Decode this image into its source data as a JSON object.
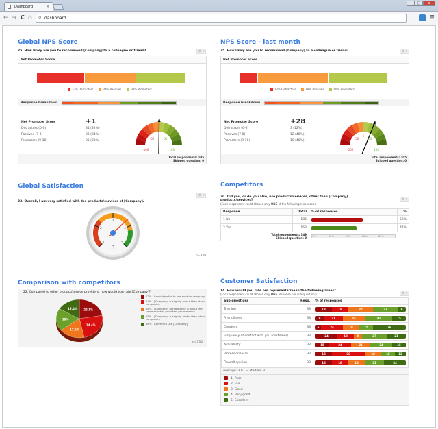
{
  "browser": {
    "tab_title": "Dashboard",
    "tab_close": "×",
    "address": "dashboard",
    "back": "←",
    "forward": "→",
    "reload": "C",
    "home": "⌂",
    "menu": "≡",
    "minimize": "–",
    "maximize": "□",
    "close": "x"
  },
  "colors": {
    "title_blue": "#3a7be0",
    "detractor": "#e8302a",
    "passive": "#f89a3e",
    "promoter": "#b4c84b",
    "poor": "#9b0d0d",
    "fair": "#d81010",
    "good": "#f0761e",
    "very_good": "#6ba12a",
    "excellent": "#3f6b13"
  },
  "gear_label": "⚙ ▾",
  "nps_global": {
    "title": "Global NPS Score",
    "question": "25.  How likely are you to recommend [Company] to a colleague or friend?",
    "header": "Net Promoter Score",
    "detractors_pct": 32,
    "passives_pct": 34,
    "promoters_pct": 33,
    "legend": [
      "32% Detractors",
      "34% Passives",
      "33% Promoters"
    ],
    "breakdown_label": "Response breakdown",
    "score_label": "Net Promoter Score",
    "score": "+1",
    "rows": [
      {
        "label": "Detractors (0-6)",
        "value": "34 (32%)"
      },
      {
        "label": "Passives (7-8)",
        "value": "36 (34%)"
      },
      {
        "label": "Promoters (9-10)",
        "value": "35 (33%)"
      }
    ],
    "gauge_value": 1,
    "gauge_labels": [
      "-100",
      "-50",
      "50",
      "100"
    ],
    "total": "Total respondents: 105",
    "skipped": "Skipped question: 0"
  },
  "nps_month": {
    "title": "NPS Score - last month",
    "question": "25.  How likely are you to recommend [Company] to a colleague or friend?",
    "header": "Net Promoter Score",
    "detractors_pct": 12,
    "passives_pct": 48,
    "promoters_pct": 40,
    "legend": [
      "12% Detractors",
      "48% Passives",
      "40% Promoters"
    ],
    "breakdown_label": "Response breakdown",
    "score_label": "Net Promoter Score",
    "score": "+28",
    "rows": [
      {
        "label": "Detractors (0-6)",
        "value": "3 (12%)"
      },
      {
        "label": "Passives (7-8)",
        "value": "12 (48%)"
      },
      {
        "label": "Promoters (9-10)",
        "value": "10 (40%)"
      }
    ],
    "gauge_value": 28,
    "gauge_labels": [
      "-100",
      "-50",
      "0",
      "50",
      "100"
    ],
    "total": "Total respondents: 105",
    "skipped": "Skipped question: 0"
  },
  "global_satisfaction": {
    "title": "Global Satisfaction",
    "question": "23. Overall, I am very satisfied with the products/services of [Company].",
    "gauge_value": "3",
    "gauge_needle": 3.7,
    "ticks": [
      "1",
      "2",
      "3",
      "4",
      "5"
    ],
    "n": "n=320"
  },
  "competitors": {
    "title": "Competitors",
    "question": "20.  Did you, or do you also, use products/services, other than [Company] products/services?",
    "note_pre": "(Each respondent could choose only ",
    "note_bold": "ONE",
    "note_post": " of the following responses.)",
    "headers": [
      "Response",
      "Total",
      "% of responses",
      "%"
    ],
    "rows": [
      {
        "label": "1 No",
        "total": "186",
        "pct": 53,
        "pct_label": "53%",
        "color": "#b30d0d"
      },
      {
        "label": "2 Yes",
        "total": "163",
        "pct": 47,
        "pct_label": "47%",
        "color": "#4b8a1a"
      }
    ],
    "total": "Total respondents: 349",
    "skipped": "Skipped question: 0",
    "axis": [
      "0%",
      "20%",
      "40%",
      "60%",
      "80%"
    ]
  },
  "comparison": {
    "title": "Comparison with competitors",
    "question": "22. Compared to other product/service providers, how would you rate [Company]?",
    "n": "n=336",
    "chart_data": {
      "type": "pie",
      "title": "22. Compared to other product/service providers, how would you rate [Company]?",
      "slices": [
        {
          "label": "22% - I would prefer to use another company",
          "value": 22.3,
          "data_label": "22.3%",
          "color": "#9b0d0d"
        },
        {
          "label": "24% - [Company] is slightly worse than other companies",
          "value": 24.4,
          "data_label": "24.4%",
          "color": "#d81010"
        },
        {
          "label": "18% - [Company] performance is about the same as other providers performance",
          "value": 17.9,
          "data_label": "17.9%",
          "color": "#f0761e"
        },
        {
          "label": "19% - [Company] is slightly better than other companies",
          "value": 19,
          "data_label": "19%",
          "color": "#6ba12a"
        },
        {
          "label": "16% - I prefer to use [Company]",
          "value": 16.4,
          "data_label": "16.4%",
          "color": "#3f6b13"
        }
      ],
      "legend": "right"
    }
  },
  "customer_satisfaction": {
    "title": "Customer Satisfaction",
    "question": "14.  How would you rate our representative in the following areas?",
    "note_pre": "(Each respondent could choose only ",
    "note_bold": "ONE",
    "note_post": " response per sub-question.)",
    "headers": [
      "Sub-questions",
      "Resp.",
      "% of responses"
    ],
    "rows": [
      {
        "label": "Training",
        "resp": "33",
        "values": [
          18,
          18,
          27,
          27,
          9
        ]
      },
      {
        "label": "Friendliness",
        "resp": "33",
        "values": [
          9,
          21,
          24,
          30,
          15
        ]
      },
      {
        "label": "Courtesy",
        "resp": "33",
        "values": [
          6,
          24,
          18,
          15,
          36
        ]
      },
      {
        "label": "Frequency of contact with you (customer)",
        "resp": "33",
        "values": [
          24,
          18,
          9,
          27,
          21
        ]
      },
      {
        "label": "Availability",
        "resp": "33",
        "values": [
          15,
          24,
          21,
          24,
          15
        ]
      },
      {
        "label": "Professionalism",
        "resp": "33",
        "values": [
          18,
          36,
          18,
          15,
          12
        ]
      },
      {
        "label": "Overall opinion",
        "resp": "33",
        "values": [
          18,
          18,
          18,
          21,
          24
        ]
      }
    ],
    "summary": "Average: 3,07 — Median: 3",
    "legend": [
      "1. Poor",
      "2. Fair",
      "3. Good",
      "4. Very good",
      "5. Excellent"
    ]
  }
}
